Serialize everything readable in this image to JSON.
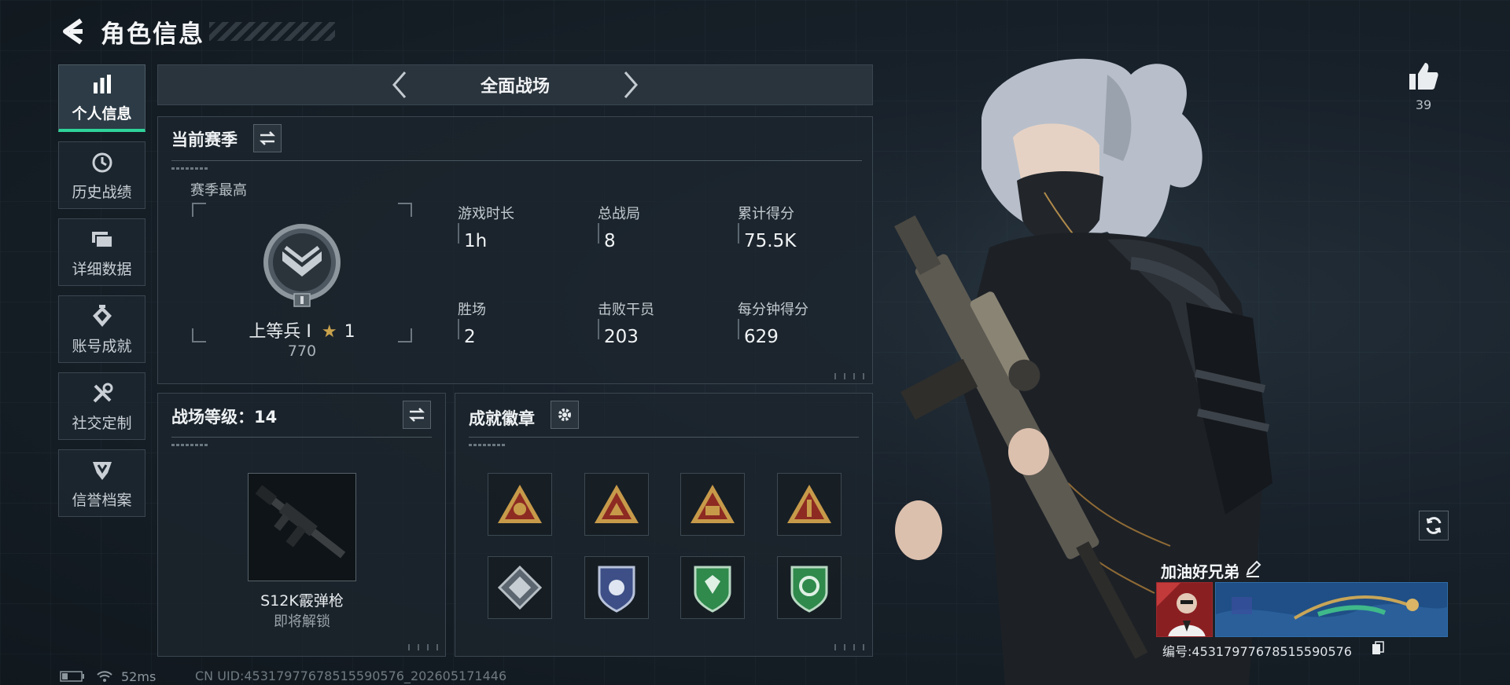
{
  "header": {
    "title": "角色信息"
  },
  "sidebar": {
    "items": [
      {
        "label": "个人信息",
        "icon": "bar-chart-icon",
        "active": true
      },
      {
        "label": "历史战绩",
        "icon": "history-clock-icon",
        "active": false
      },
      {
        "label": "详细数据",
        "icon": "folders-icon",
        "active": false
      },
      {
        "label": "账号成就",
        "icon": "achievement-icon",
        "active": false
      },
      {
        "label": "社交定制",
        "icon": "tools-icon",
        "active": false
      },
      {
        "label": "信誉档案",
        "icon": "credit-shield-icon",
        "active": false
      }
    ]
  },
  "mode_bar": {
    "mode": "全面战场"
  },
  "season": {
    "title": "当前赛季",
    "best_label": "赛季最高",
    "rank_name": "上等兵 Ⅰ",
    "rank_stars": "1",
    "rank_points": "770",
    "stats": [
      {
        "label": "游戏时长",
        "value": "1h"
      },
      {
        "label": "总战局",
        "value": "8"
      },
      {
        "label": "累计得分",
        "value": "75.5K"
      },
      {
        "label": "胜场",
        "value": "2"
      },
      {
        "label": "击败干员",
        "value": "203"
      },
      {
        "label": "每分钟得分",
        "value": "629"
      }
    ]
  },
  "battlefield_level": {
    "title": "战场等级：14",
    "weapon_name": "S12K霰弹枪",
    "weapon_status": "即将解锁"
  },
  "achievements": {
    "title": "成就徽章",
    "medals": [
      {
        "icon": "triangle-medal-icon"
      },
      {
        "icon": "triangle-medal-icon"
      },
      {
        "icon": "triangle-medal-icon"
      },
      {
        "icon": "triangle-medal-icon"
      },
      {
        "icon": "diamond-medal-icon"
      },
      {
        "icon": "shield-medal-icon"
      },
      {
        "icon": "green-shield-medal-icon"
      },
      {
        "icon": "green-shield-medal-icon"
      }
    ]
  },
  "profile": {
    "likes": "39",
    "player_name": "加油好兄弟",
    "uid_text": "编号:4531797767851559057​6"
  },
  "status": {
    "ping": "52ms",
    "cn_uid": "CN UID:45317977678515590576_202605171446"
  },
  "colors": {
    "accent_green": "#2fd39a",
    "medal_gold": "#c79a4a",
    "medal_red": "#8d2a22",
    "medal_green": "#2f8a4c",
    "banner_blue": "#2a5f9a"
  }
}
